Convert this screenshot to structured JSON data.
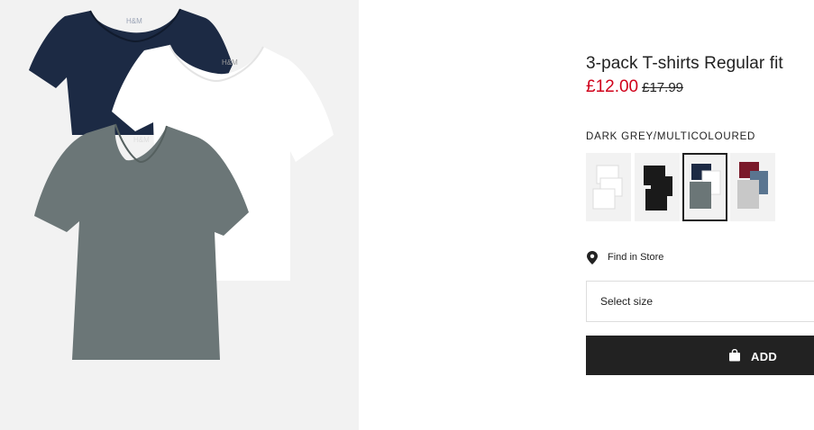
{
  "product": {
    "title": "3-pack T-shirts Regular fit",
    "price_sale": "£12.00",
    "price_original": "£17.99",
    "color_selected": "DARK GREY/MULTICOLOURED",
    "brand_logo_text": "H&M"
  },
  "swatches": [
    {
      "name": "white",
      "selected": false,
      "shirt_colors": [
        "#ffffff",
        "#ffffff",
        "#ffffff"
      ]
    },
    {
      "name": "black",
      "selected": false,
      "shirt_colors": [
        "#1a1a1a",
        "#1a1a1a",
        "#1a1a1a"
      ]
    },
    {
      "name": "dark-grey-multicoloured",
      "selected": true,
      "shirt_colors": [
        "#1c2a44",
        "#ffffff",
        "#6b7677"
      ]
    },
    {
      "name": "burgundy-multicoloured",
      "selected": false,
      "shirt_colors": [
        "#7a1a2a",
        "#5a7590",
        "#c8c8c8"
      ]
    }
  ],
  "store": {
    "find_in_store": "Find in Store",
    "icon": "map-pin-icon"
  },
  "size": {
    "placeholder": "Select size"
  },
  "cart": {
    "add_label": "ADD",
    "icon": "shopping-bag-icon"
  },
  "colors": {
    "sale_red": "#d0021b",
    "button_dark": "#222222",
    "image_bg": "#f2f2f2",
    "navy_shirt": "#1c2a44",
    "grey_shirt": "#6b7677"
  }
}
